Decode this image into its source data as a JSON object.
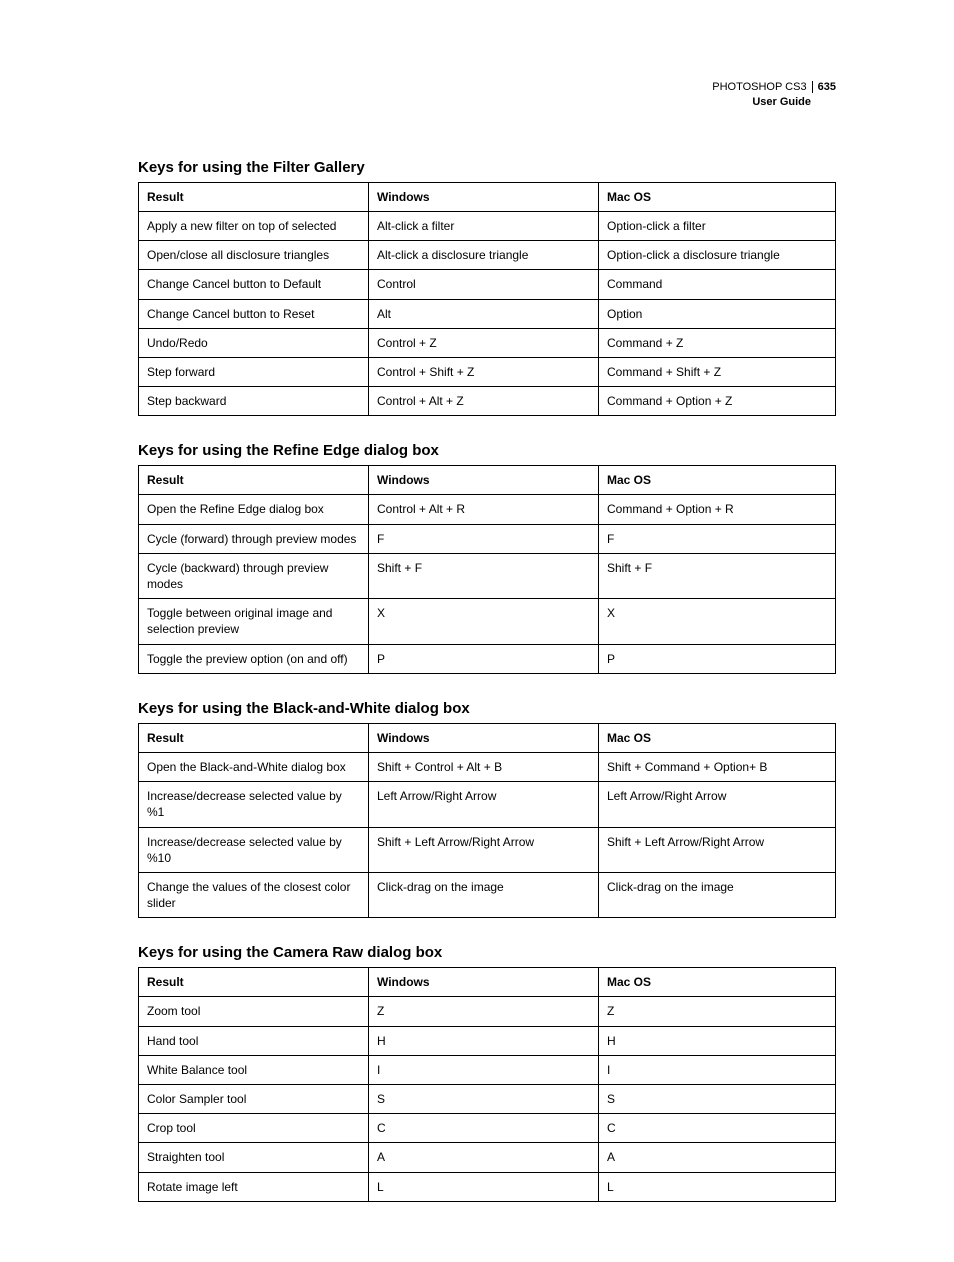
{
  "header": {
    "product": "PHOTOSHOP CS3",
    "page_number": "635",
    "doc_title": "User Guide"
  },
  "columns": {
    "result": "Result",
    "windows": "Windows",
    "macos": "Mac OS"
  },
  "sections": [
    {
      "title": "Keys for using the Filter Gallery",
      "rows": [
        {
          "result": "Apply a new filter on top of selected",
          "windows": "Alt-click a filter",
          "macos": "Option-click a filter"
        },
        {
          "result": "Open/close all disclosure triangles",
          "windows": "Alt-click a disclosure triangle",
          "macos": "Option-click a disclosure triangle"
        },
        {
          "result": "Change Cancel button to Default",
          "windows": "Control",
          "macos": "Command"
        },
        {
          "result": "Change Cancel button to Reset",
          "windows": "Alt",
          "macos": "Option"
        },
        {
          "result": "Undo/Redo",
          "windows": "Control + Z",
          "macos": "Command + Z"
        },
        {
          "result": "Step forward",
          "windows": "Control + Shift + Z",
          "macos": "Command + Shift + Z"
        },
        {
          "result": "Step backward",
          "windows": "Control + Alt + Z",
          "macos": "Command + Option + Z"
        }
      ]
    },
    {
      "title": "Keys for using the Refine Edge dialog box",
      "rows": [
        {
          "result": "Open the Refine Edge dialog box",
          "windows": "Control + Alt + R",
          "macos": "Command + Option + R"
        },
        {
          "result": "Cycle (forward) through preview modes",
          "windows": "F",
          "macos": "F"
        },
        {
          "result": "Cycle (backward) through preview modes",
          "windows": "Shift + F",
          "macos": "Shift + F"
        },
        {
          "result": "Toggle between original image and selection preview",
          "windows": "X",
          "macos": "X"
        },
        {
          "result": "Toggle the preview option (on and off)",
          "windows": "P",
          "macos": "P"
        }
      ]
    },
    {
      "title": "Keys for using the Black-and-White dialog box",
      "rows": [
        {
          "result": "Open the Black-and-White dialog box",
          "windows": "Shift + Control + Alt + B",
          "macos": "Shift + Command + Option+ B"
        },
        {
          "result": "Increase/decrease selected value by %1",
          "windows": "Left Arrow/Right Arrow",
          "macos": "Left Arrow/Right Arrow"
        },
        {
          "result": "Increase/decrease selected value by %10",
          "windows": "Shift + Left Arrow/Right Arrow",
          "macos": "Shift + Left Arrow/Right Arrow"
        },
        {
          "result": "Change the values of the closest color slider",
          "windows": "Click-drag on the image",
          "macos": "Click-drag on the image"
        }
      ]
    },
    {
      "title": "Keys for using the Camera Raw dialog box",
      "rows": [
        {
          "result": "Zoom tool",
          "windows": "Z",
          "macos": "Z"
        },
        {
          "result": "Hand tool",
          "windows": "H",
          "macos": "H"
        },
        {
          "result": "White Balance tool",
          "windows": "I",
          "macos": "I"
        },
        {
          "result": "Color Sampler tool",
          "windows": "S",
          "macos": "S"
        },
        {
          "result": "Crop tool",
          "windows": "C",
          "macos": "C"
        },
        {
          "result": "Straighten tool",
          "windows": "A",
          "macos": "A"
        },
        {
          "result": "Rotate image left",
          "windows": "L",
          "macos": "L"
        }
      ]
    }
  ]
}
